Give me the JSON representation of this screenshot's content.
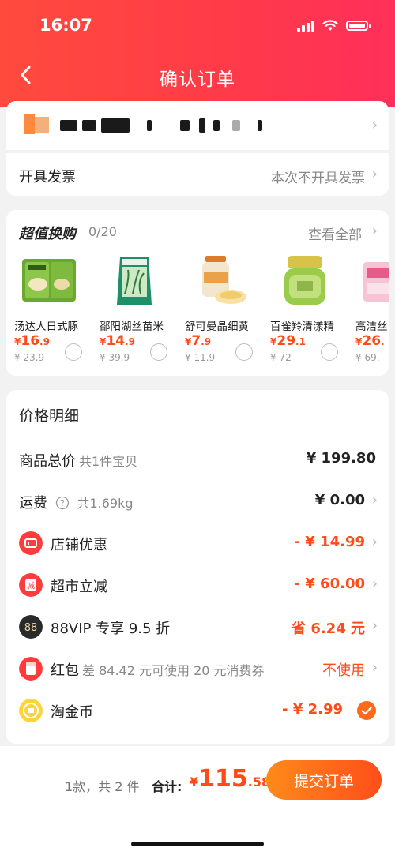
{
  "status": {
    "time": "16:07"
  },
  "header": {
    "title": "确认订单"
  },
  "invoice": {
    "label": "开具发票",
    "value": "本次不开具发票"
  },
  "deals": {
    "title": "超值换购",
    "count": "0/20",
    "view_all": "查看全部",
    "products": [
      {
        "name": "汤达人日式豚",
        "price_int": "16",
        "price_dec": ".9",
        "old": "¥ 23.9",
        "icon": "noodle-pack-icon"
      },
      {
        "name": "鄱阳湖丝苗米",
        "price_int": "14",
        "price_dec": ".9",
        "old": "¥ 39.9",
        "icon": "rice-bag-icon"
      },
      {
        "name": "舒可曼晶细黄",
        "price_int": "7",
        "price_dec": ".9",
        "old": "¥ 11.9",
        "icon": "sugar-jar-icon"
      },
      {
        "name": "百雀羚清漾精",
        "price_int": "29",
        "price_dec": ".1",
        "old": "¥ 72",
        "icon": "cream-jar-icon"
      },
      {
        "name": "高洁丝",
        "price_int": "26",
        "price_dec": ".",
        "old": "¥ 69.",
        "icon": "pad-pack-icon"
      }
    ],
    "currency": "¥"
  },
  "price": {
    "title": "价格明细",
    "rows": {
      "goods": {
        "label": "商品总价",
        "sub": "共1件宝贝",
        "value": "¥ 199.80"
      },
      "shipping": {
        "label": "运费",
        "sub": "共1.69kg",
        "value": "¥ 0.00"
      },
      "store": {
        "label": "店铺优惠",
        "value": "- ¥ 14.99"
      },
      "market": {
        "label": "超市立减",
        "value": "- ¥ 60.00"
      },
      "vip": {
        "label": "88VIP 专享 9.5 折",
        "value": "省 6.24 元"
      },
      "redpack": {
        "label": "红包",
        "sub": "差 84.42 元可使用 20 元消费券",
        "value": "不使用"
      },
      "coin": {
        "label": "淘金币",
        "value": "- ¥ 2.99"
      }
    }
  },
  "footer": {
    "summary": "1款，共 2 件",
    "total_label": "合计:",
    "currency": "¥",
    "amount_int": "115",
    "amount_dec": ".58",
    "submit": "提交订单"
  },
  "colors": {
    "accent": "#ff4a1a",
    "header": "#ff3b48"
  }
}
